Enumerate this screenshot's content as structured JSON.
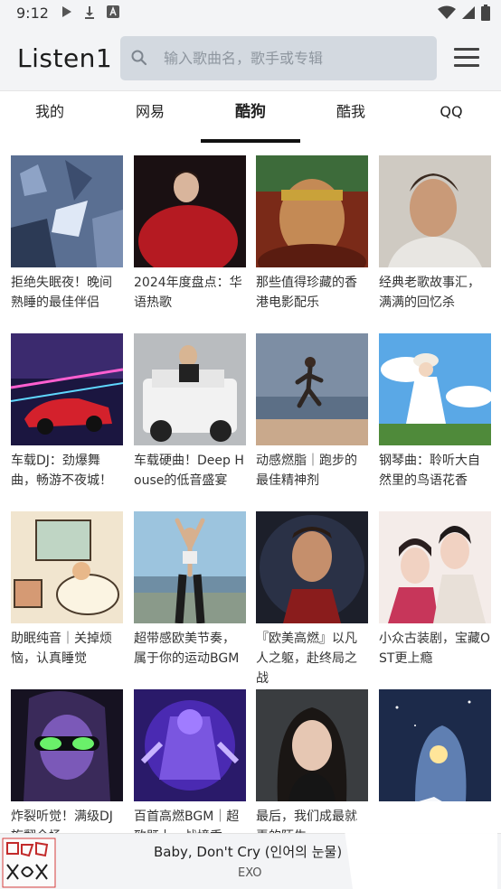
{
  "status": {
    "time": "9:12"
  },
  "header": {
    "title": "Listen1",
    "search_placeholder": "输入歌曲名，歌手或专辑"
  },
  "tabs": [
    {
      "label": "我的"
    },
    {
      "label": "网易"
    },
    {
      "label": "酷狗"
    },
    {
      "label": "酷我"
    },
    {
      "label": "QQ"
    }
  ],
  "active_tab": "酷狗",
  "playlists": [
    {
      "title": "拒绝失眠夜！晚间熟睡的最佳伴侣"
    },
    {
      "title": "2024年度盘点：华语热歌"
    },
    {
      "title": "那些值得珍藏的香港电影配乐"
    },
    {
      "title": "经典老歌故事汇，满满的回忆杀"
    },
    {
      "title": "车载DJ：劲爆舞曲，畅游不夜城！"
    },
    {
      "title": "车载硬曲！Deep House的低音盛宴"
    },
    {
      "title": "动感燃脂｜跑步的最佳精神剂"
    },
    {
      "title": "钢琴曲：聆听大自然里的鸟语花香"
    },
    {
      "title": "助眠纯音｜关掉烦恼，认真睡觉"
    },
    {
      "title": "超带感欧美节奏，属于你的运动BGM"
    },
    {
      "title": "『欧美高燃』以凡人之躯，赴终局之战"
    },
    {
      "title": "小众古装剧，宝藏OST更上瘾"
    },
    {
      "title": "炸裂听觉！满级DJ旋翻全场"
    },
    {
      "title": "百首高燃BGM｜超致既上，战境乘"
    },
    {
      "title": "最后，我们成最就弄的陌生"
    },
    {
      "title": ""
    }
  ],
  "player": {
    "song": "Baby, Don't Cry (인어의 눈물)",
    "artist": "EXO"
  },
  "colors": {
    "chrome_background": "#f3f4f6",
    "search_background": "#d3d9e0",
    "tab_indicator": "#111111"
  }
}
